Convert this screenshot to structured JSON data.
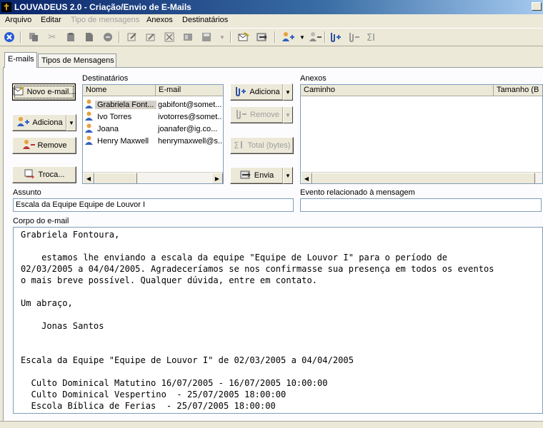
{
  "window": {
    "title": "LOUVADEUS 2.0 - Criação/Envio de E-Mails"
  },
  "menu": [
    {
      "label": "Arquivo",
      "enabled": true
    },
    {
      "label": "Editar",
      "enabled": true
    },
    {
      "label": "Tipo de mensagens",
      "enabled": false
    },
    {
      "label": "Anexos",
      "enabled": true
    },
    {
      "label": "Destinatários",
      "enabled": true
    }
  ],
  "toolbar": {
    "icons": [
      "close-circle-icon",
      "copy-icon",
      "cut-icon",
      "paste-icon",
      "document-icon",
      "stop-icon",
      "edit-icon",
      "edit-alt-icon",
      "delete-icon",
      "grid-icon",
      "save-icon",
      "dropdown-icon",
      "send-mail-icon",
      "card-icon",
      "add-user-icon",
      "dropdown-icon",
      "remove-user-icon",
      "attach-add-icon",
      "attach-remove-icon",
      "sum-icon"
    ]
  },
  "tabs": [
    {
      "label": "E-mails",
      "active": true
    },
    {
      "label": "Tipos de Mensagens",
      "active": false
    }
  ],
  "buttons": {
    "novo_email": "Novo e-mail...",
    "adiciona_dest": "Adiciona",
    "remove_dest": "Remove",
    "troca": "Troca...",
    "adiciona_anexo": "Adiciona",
    "remove_anexo": "Remove",
    "total": "Total (bytes)",
    "envia": "Envia"
  },
  "destinatarios": {
    "label": "Destinatários",
    "columns": [
      "Nome",
      "E-mail"
    ],
    "rows": [
      {
        "nome": "Grabriela Font...",
        "email": "gabifont@somet...",
        "selected": true
      },
      {
        "nome": "Ivo Torres",
        "email": "ivotorres@somet...",
        "selected": false
      },
      {
        "nome": "Joana",
        "email": "joanafer@ig.co...",
        "selected": false
      },
      {
        "nome": "Henry Maxwell",
        "email": "henrymaxwell@s...",
        "selected": false
      }
    ]
  },
  "anexos": {
    "label": "Anexos",
    "columns": [
      "Caminho",
      "Tamanho (B"
    ]
  },
  "assunto": {
    "label": "Assunto",
    "value": "Escala da Equipe Equipe de Louvor I"
  },
  "evento": {
    "label": "Evento relacionado à mensagem",
    "value": ""
  },
  "corpo": {
    "label": "Corpo do e-mail",
    "text": "Grabriela Fontoura,\n\n    estamos lhe enviando a escala da equipe \"Equipe de Louvor I\" para o período de\n02/03/2005 a 04/04/2005. Agradeceríamos se nos confirmasse sua presença em todos os eventos\no mais breve possível. Qualquer dúvida, entre em contato.\n\nUm abraço,\n\n    Jonas Santos\n\n\nEscala da Equipe \"Equipe de Louvor I\" de 02/03/2005 a 04/04/2005\n\n  Culto Dominical Matutino 16/07/2005 - 16/07/2005 10:00:00\n  Culto Dominical Vespertino  - 25/07/2005 18:00:00\n  Escola Bíblica de Ferias  - 25/07/2005 18:00:00"
  }
}
